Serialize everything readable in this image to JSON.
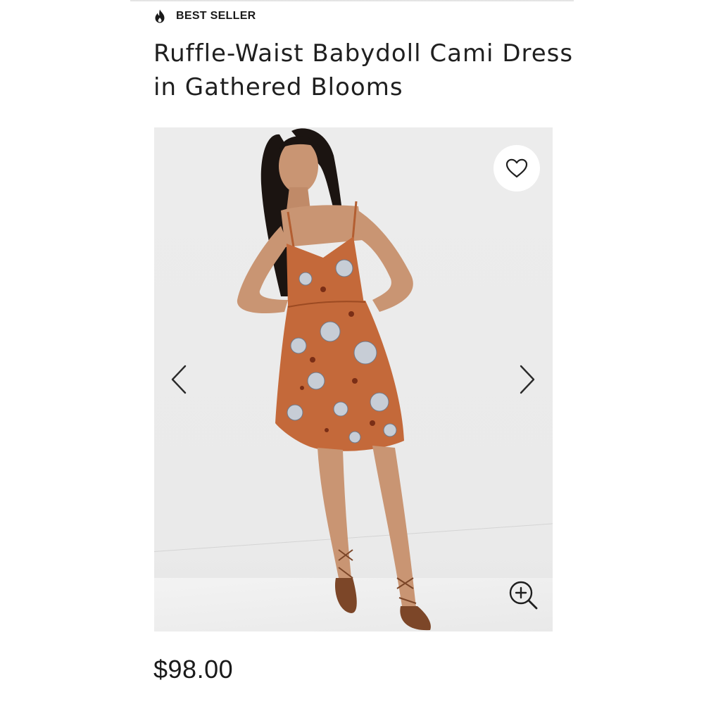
{
  "badge": {
    "icon": "flame-icon",
    "label": "BEST SELLER"
  },
  "product": {
    "title": "Ruffle-Waist Babydoll Cami Dress in Gathered Blooms",
    "price": "$98.00"
  },
  "gallery": {
    "wishlist_icon": "heart-outline-icon",
    "prev_icon": "chevron-left-icon",
    "next_icon": "chevron-right-icon",
    "zoom_icon": "zoom-in-icon"
  },
  "colors": {
    "text": "#1f1f1f",
    "dress": "#c4693a",
    "background": "#ffffff",
    "photo_background": "#ececec"
  }
}
